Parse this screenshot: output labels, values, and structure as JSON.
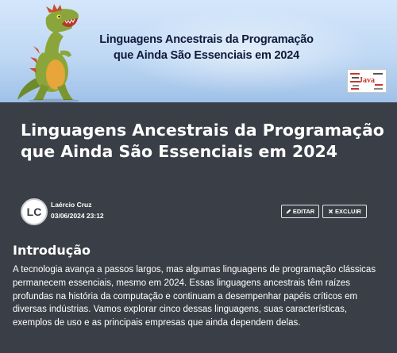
{
  "banner": {
    "title_line1": "Linguagens Ancestrais da Programação",
    "title_line2": "que Ainda São Essenciais em 2024",
    "badge_text": "Java"
  },
  "article": {
    "title": "Linguagens Ancestrais da Programação que Ainda São Essenciais em 2024",
    "author": {
      "initials": "LC",
      "name": "Laércio Cruz",
      "date": "03/06/2024 23:12"
    },
    "actions": {
      "edit_label": "EDITAR",
      "delete_label": "EXCLUIR",
      "edit_icon": "pencil-icon",
      "delete_icon": "x-icon"
    },
    "section": {
      "heading": "Introdução",
      "text": "A tecnologia avança a passos largos, mas algumas linguagens de programação clássicas permanecem essenciais, mesmo em 2024. Essas linguagens ancestrais têm raízes profundas na história da computação e continuam a desempenhar papéis críticos em diversas indústrias. Vamos explorar cinco dessas linguagens, suas características, exemplos de uso e as principais empresas que ainda dependem delas."
    }
  },
  "colors": {
    "background": "#3a3f47",
    "banner_sky": "#bfd8f4",
    "text": "#ffffff"
  }
}
